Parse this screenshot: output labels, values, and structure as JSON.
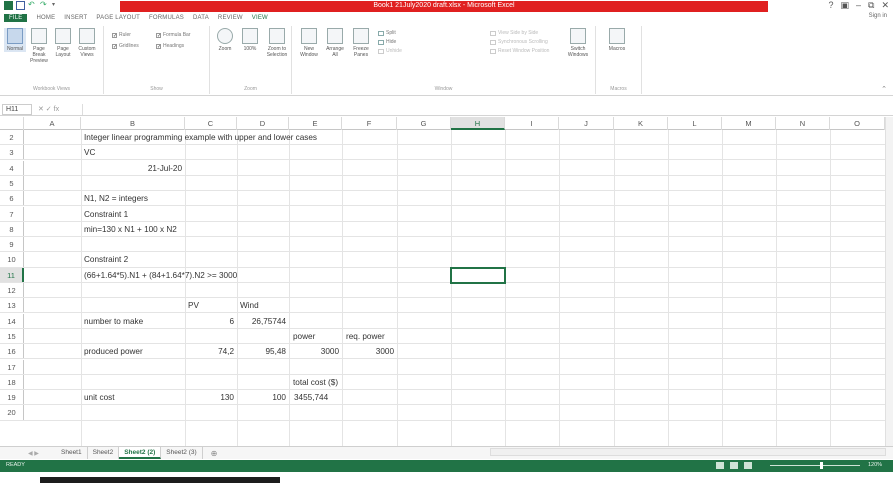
{
  "window": {
    "title": "Book1 21July2020 draft.xlsx - Microsoft Excel",
    "controls": [
      "?",
      "▣",
      "–",
      "⧉",
      "✕"
    ]
  },
  "ribbon": {
    "tabs": [
      "FILE",
      "HOME",
      "INSERT",
      "PAGE LAYOUT",
      "FORMULAS",
      "DATA",
      "REVIEW",
      "VIEW"
    ],
    "active_tab": "VIEW",
    "sign_in": "Sign in",
    "workbook_views": {
      "label": "Workbook Views",
      "buttons": [
        "Normal",
        "Page Break Preview",
        "Page Layout",
        "Custom Views"
      ]
    },
    "show": {
      "label": "Show",
      "ruler": "Ruler",
      "formula_bar": "Formula Bar",
      "gridlines": "Gridlines",
      "headings": "Headings"
    },
    "zoom": {
      "label": "Zoom",
      "buttons": [
        "Zoom",
        "100%",
        "Zoom to Selection"
      ]
    },
    "window": {
      "label": "Window",
      "buttons": [
        "New Window",
        "Arrange All",
        "Freeze Panes"
      ],
      "split": "Split",
      "hide": "Hide",
      "unhide": "Unhide",
      "view_side_by_side": "View Side by Side",
      "sync_scrolling": "Synchronous Scrolling",
      "reset_position": "Reset Window Position",
      "switch_windows": "Switch Windows"
    },
    "macros": {
      "label": "Macros",
      "button": "Macros"
    }
  },
  "formula_bar": {
    "name_box": "H11",
    "buttons": "✕  ✓  fx",
    "content": ""
  },
  "grid": {
    "columns": [
      "A",
      "B",
      "C",
      "D",
      "E",
      "F",
      "G",
      "H",
      "I",
      "J",
      "K",
      "L",
      "M",
      "N",
      "O"
    ],
    "selected_column": "H",
    "row_numbers": [
      "2",
      "3",
      "4",
      "5",
      "6",
      "7",
      "8",
      "9",
      "10",
      "11",
      "12",
      "13",
      "14",
      "15",
      "16",
      "17",
      "18",
      "19",
      "20"
    ],
    "selected_row": "11",
    "active_cell": "H11",
    "cells": {
      "B2": "Integer linear programming example with upper and lower cases",
      "B3": "VC",
      "B4": "21-Jul-20",
      "B6": "N1, N2 = integers",
      "B7": "Constraint 1",
      "B8": "min=130 x N1 + 100 x N2",
      "B10": "Constraint 2",
      "B11": "(66+1.64*5).N1 + (84+1.64*7).N2 >= 3000",
      "C13": "PV",
      "D13": "Wind",
      "B14": "number to make",
      "C14": "6",
      "D14": "26,75744",
      "E15": "power",
      "F15": "req. power",
      "B16": "produced power",
      "C16": "74,2",
      "D16": "95,48",
      "E16": "3000",
      "F16": "3000",
      "E18": "total cost  ($)",
      "B19": "unit cost",
      "C19": "130",
      "D19": "100",
      "E19": "3455,744"
    }
  },
  "sheets": {
    "tabs": [
      "Sheet1",
      "Sheet2",
      "Sheet2 (2)",
      "Sheet2 (3)"
    ],
    "active": "Sheet2 (2)",
    "add": "⊕"
  },
  "status": {
    "ready": "READY",
    "zoom": "120%"
  }
}
